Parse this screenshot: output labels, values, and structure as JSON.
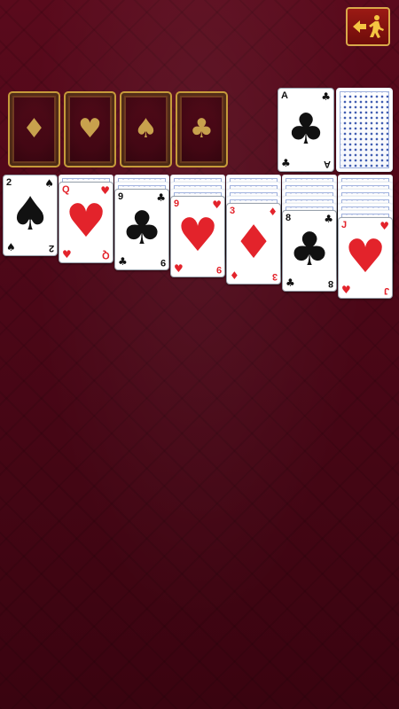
{
  "toolbar": {
    "exit_icon": "exit-running-man-icon",
    "accent": "#d9a94a"
  },
  "foundations": [
    {
      "suit": "diamonds",
      "symbol": "♦"
    },
    {
      "suit": "hearts",
      "symbol": "♥"
    },
    {
      "suit": "spades",
      "symbol": "♠"
    },
    {
      "suit": "clubs",
      "symbol": "♣"
    }
  ],
  "waste": {
    "rank": "A",
    "suit": "clubs",
    "symbol": "♣",
    "color": "black"
  },
  "stock": {
    "face": "down"
  },
  "tableau": [
    {
      "hidden": 0,
      "rank": "2",
      "suit": "spades",
      "symbol": "♠",
      "color": "black"
    },
    {
      "hidden": 1,
      "rank": "Q",
      "suit": "hearts",
      "symbol": "♥",
      "color": "red"
    },
    {
      "hidden": 2,
      "rank": "9",
      "suit": "clubs",
      "symbol": "♣",
      "color": "black"
    },
    {
      "hidden": 3,
      "rank": "9",
      "suit": "hearts",
      "symbol": "♥",
      "color": "red"
    },
    {
      "hidden": 4,
      "rank": "3",
      "suit": "diamonds",
      "symbol": "♦",
      "color": "red"
    },
    {
      "hidden": 5,
      "rank": "8",
      "suit": "clubs",
      "symbol": "♣",
      "color": "black"
    },
    {
      "hidden": 6,
      "rank": "J",
      "suit": "hearts",
      "symbol": "♥",
      "color": "red"
    }
  ],
  "colors": {
    "felt": "#4b0717",
    "red_suit": "#e3232b",
    "black_suit": "#111111",
    "foundation_gold": "#c8a14d",
    "card_back_pattern": "#3d5ab0"
  }
}
